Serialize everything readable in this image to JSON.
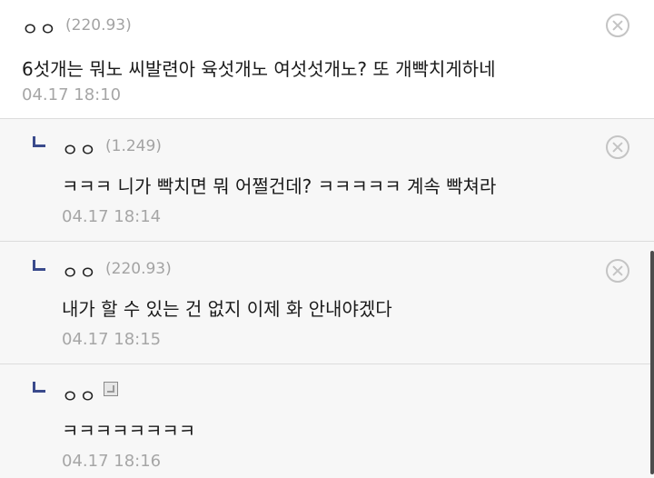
{
  "comments": [
    {
      "nickname": "ㅇㅇ",
      "ip": "(220.93)",
      "text": "6섯개는 뭐노 씨발련아 육섯개노 여섯섯개노? 또 개빡치게하네",
      "time": "04.17 18:10"
    }
  ],
  "replies": [
    {
      "nickname": "ㅇㅇ",
      "ip": "(1.249)",
      "text": "ㅋㅋㅋ 니가 빡치면 뭐 어쩔건데? ㅋㅋㅋㅋㅋ 계속 빡쳐라",
      "time": "04.17 18:14"
    },
    {
      "nickname": "ㅇㅇ",
      "ip": "(220.93)",
      "text": "내가 할 수 있는 건 없지 이제 화 안내야겠다",
      "time": "04.17 18:15"
    },
    {
      "nickname": "ㅇㅇ",
      "member_icon": "fixed-nickname-icon",
      "text": "ㅋㅋㅋㅋㅋㅋㅋㅋ",
      "time": "04.17 18:16"
    }
  ],
  "colors": {
    "reply_arrow": "#3a4a8c",
    "reply_background": "#f7f7f7",
    "ip_text": "#a3a3a3",
    "timestamp": "#a6a6a6",
    "delete_icon": "#c4c4c4"
  }
}
